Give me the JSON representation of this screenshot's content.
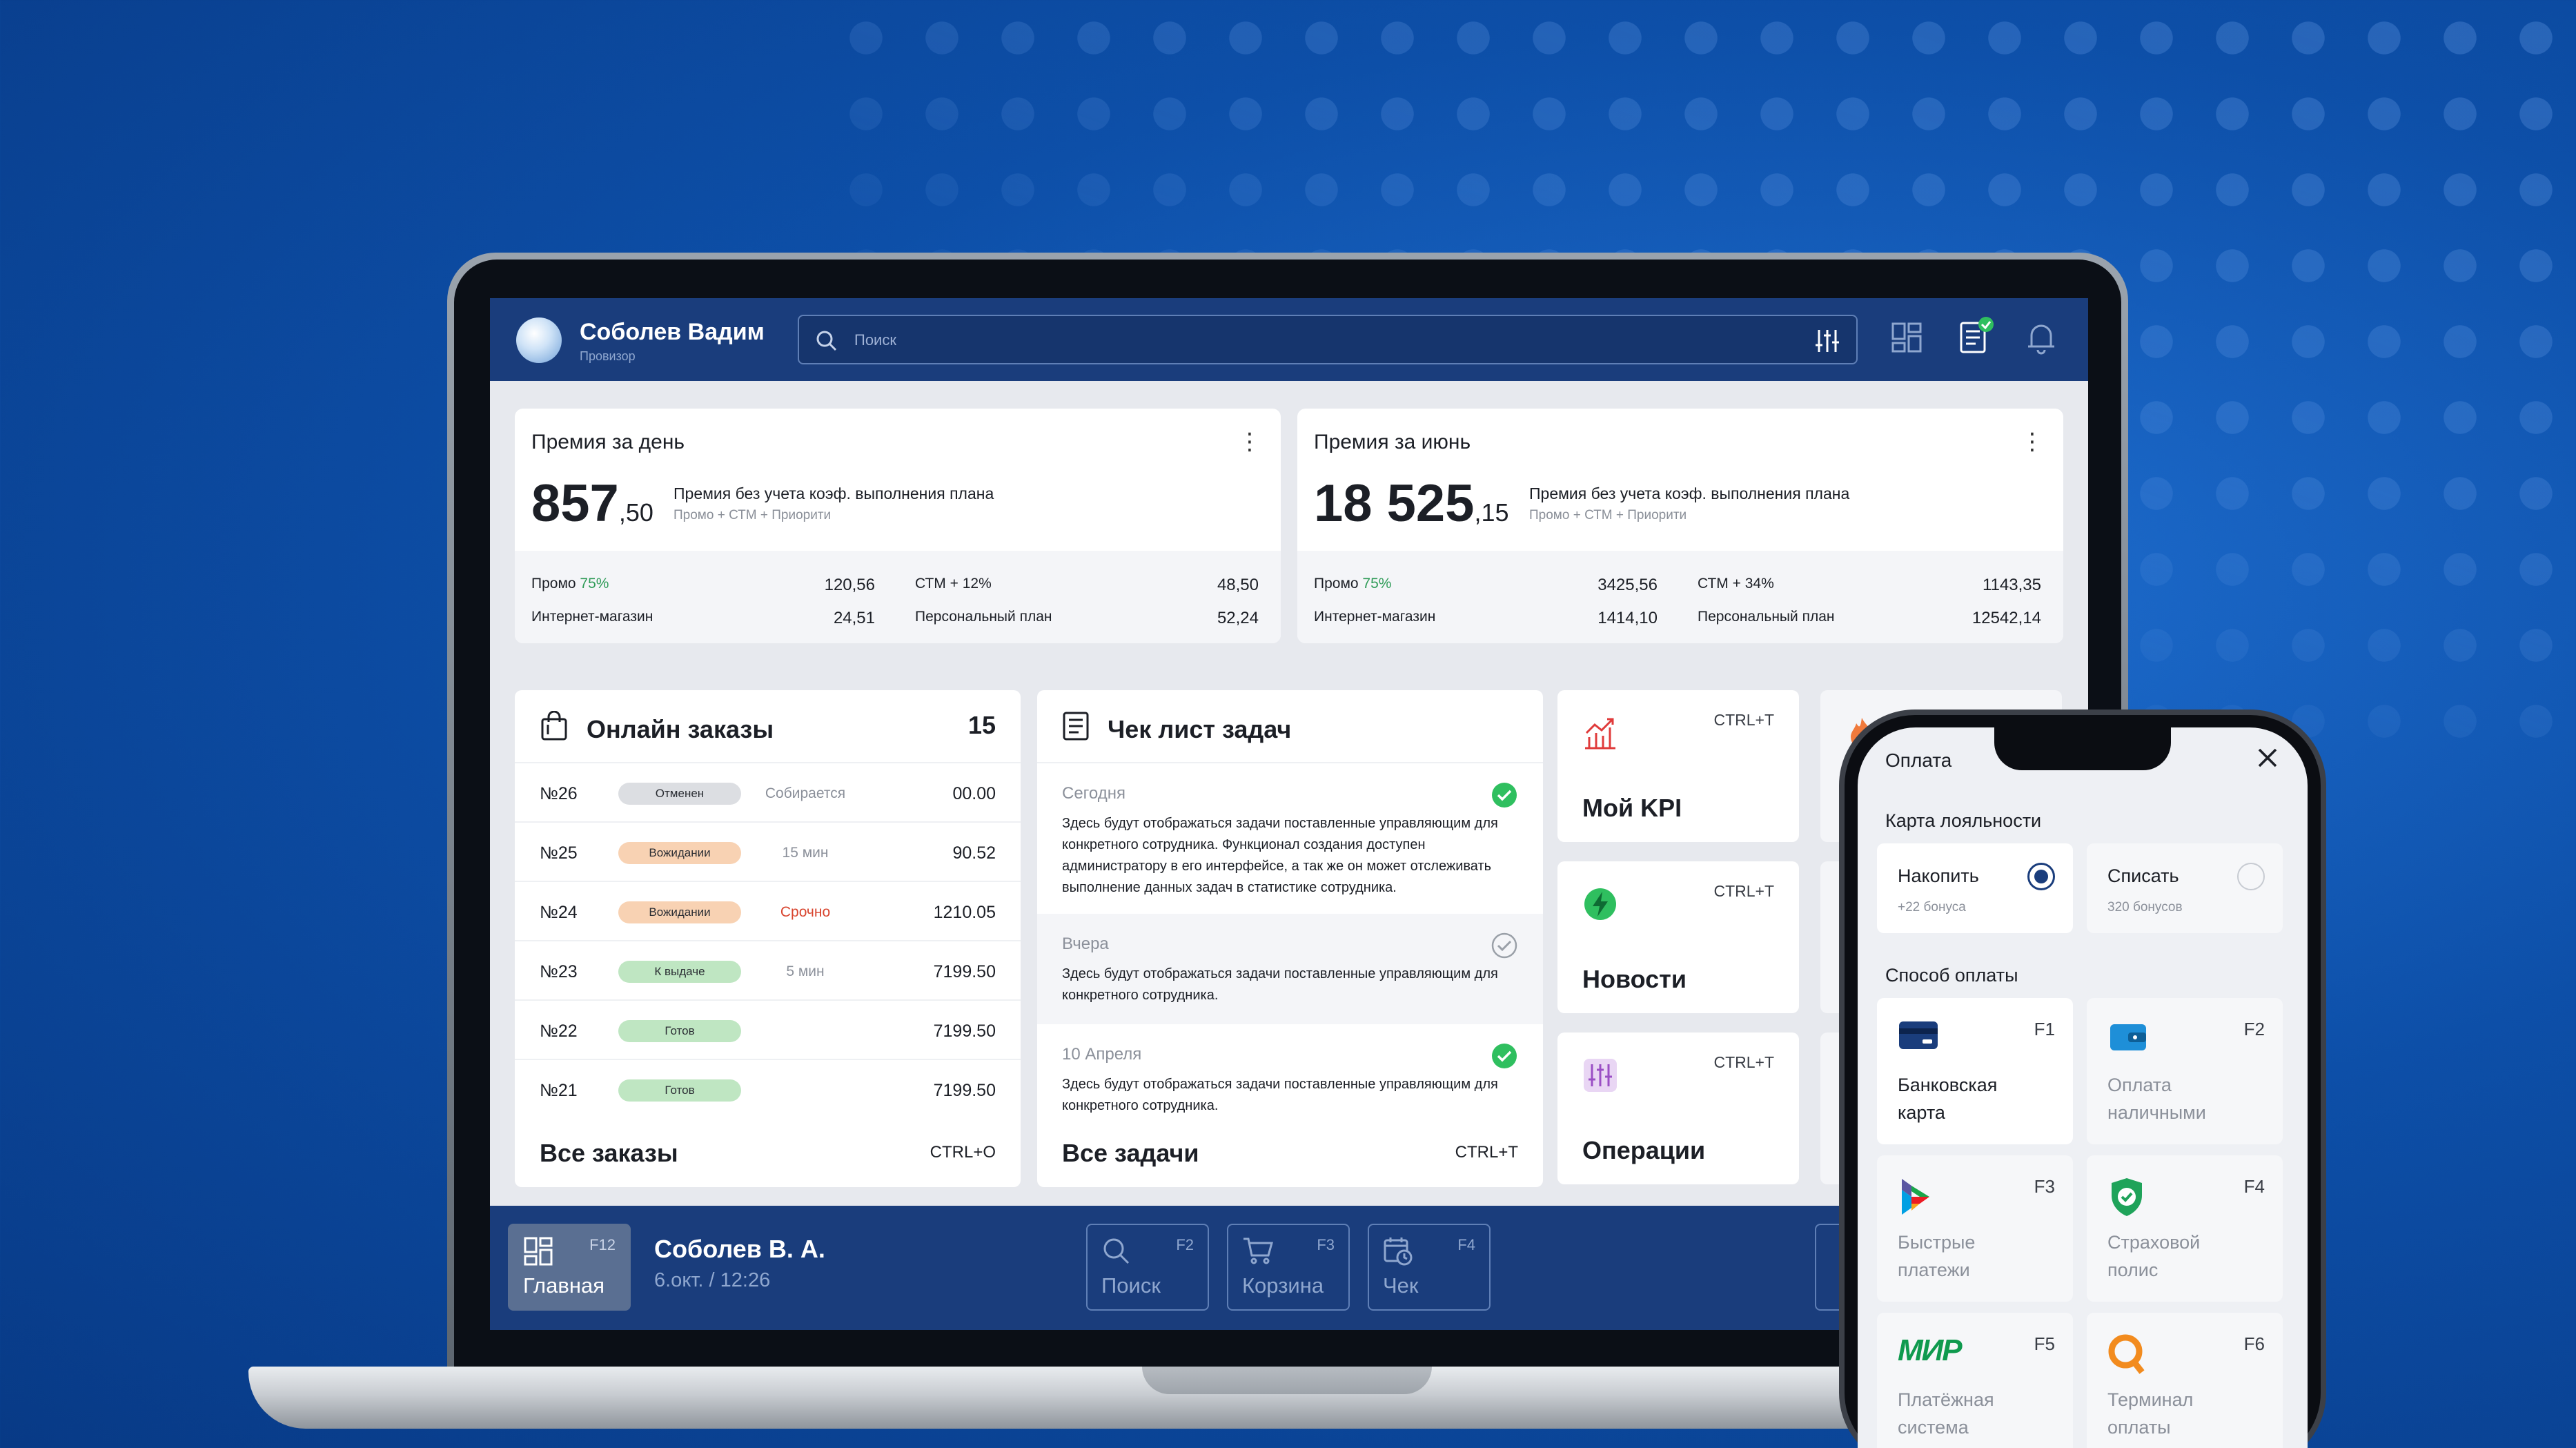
{
  "colors": {
    "brand": "#1a3d7c",
    "accent_green": "#2e9b57",
    "background": "#0d4fa8"
  },
  "header": {
    "user_name": "Соболев Вадим",
    "user_role": "Провизор",
    "search_placeholder": "Поиск",
    "icons": [
      "search-icon",
      "filter-icon",
      "layout-icon",
      "document-check-icon",
      "bell-icon"
    ]
  },
  "premium_day": {
    "title": "Премия за день",
    "amount_int": "857",
    "amount_dec": ",50",
    "desc": "Премия без учета коэф. выполнения плана",
    "sub": "Промо + СТМ + Приорити",
    "left": [
      {
        "label": "Промо",
        "pct": "75%",
        "value": "120,56"
      },
      {
        "label": "Интернет-магазин",
        "pct": "",
        "value": "24,51"
      }
    ],
    "right": [
      {
        "label": "СТМ + 12%",
        "value": "48,50"
      },
      {
        "label": "Персональный план",
        "value": "52,24"
      }
    ]
  },
  "premium_month": {
    "title": "Премия за июнь",
    "amount_int": "18 525",
    "amount_dec": ",15",
    "desc": "Премия без учета коэф. выполнения плана",
    "sub": "Промо + СТМ + Приорити",
    "left": [
      {
        "label": "Промо",
        "pct": "75%",
        "value": "3425,56"
      },
      {
        "label": "Интернет-магазин",
        "pct": "",
        "value": "1414,10"
      }
    ],
    "right": [
      {
        "label": "СТМ + 34%",
        "value": "1143,35"
      },
      {
        "label": "Персональный план",
        "value": "12542,14"
      }
    ]
  },
  "orders": {
    "title": "Онлайн заказы",
    "count": "15",
    "rows": [
      {
        "num": "№26",
        "status": "Отменен",
        "pill_color": "#dcdee2",
        "state": "Собирается",
        "state_color": "#8b909a",
        "amount": "00.00"
      },
      {
        "num": "№25",
        "status": "Вожидании",
        "pill_color": "#f8d2b3",
        "state": "15 мин",
        "state_color": "#8b909a",
        "amount": "90.52"
      },
      {
        "num": "№24",
        "status": "Вожидании",
        "pill_color": "#f8d2b3",
        "state": "Срочно",
        "state_color": "#d8452f",
        "amount": "1210.05"
      },
      {
        "num": "№23",
        "status": "К выдаче",
        "pill_color": "#bfe6c2",
        "state": "5 мин",
        "state_color": "#8b909a",
        "amount": "7199.50"
      },
      {
        "num": "№22",
        "status": "Готов",
        "pill_color": "#bfe6c2",
        "state": "",
        "state_color": "#8b909a",
        "amount": "7199.50"
      },
      {
        "num": "№21",
        "status": "Готов",
        "pill_color": "#bfe6c2",
        "state": "",
        "state_color": "#8b909a",
        "amount": "7199.50"
      }
    ],
    "footer": "Все заказы",
    "shortcut": "CTRL+O"
  },
  "checklist": {
    "title": "Чек лист задач",
    "tasks": [
      {
        "date": "Сегодня",
        "text": "Здесь будут отображаться задачи поставленные управляющим для конкретного сотрудника. Функционал создания доступен администратору в его интерфейсе, а так же он может отслеживать выполнение данных задач в статистике сотрудника.",
        "done": true
      },
      {
        "date": "Вчера",
        "text": "Здесь будут отображаться задачи поставленные управляющим для конкретного сотрудника.",
        "done": false
      },
      {
        "date": "10 Апреля",
        "text": "Здесь будут отображаться задачи поставленные управляющим для конкретного сотрудника.",
        "done": true
      }
    ],
    "footer": "Все задачи",
    "shortcut": "CTRL+T"
  },
  "tiles": [
    {
      "label": "Мой KPI",
      "shortcut": "CTRL+T",
      "icon": "chart-icon"
    },
    {
      "label": "Новости",
      "shortcut": "CTRL+T",
      "icon": "lightning-icon"
    },
    {
      "label": "Операции",
      "shortcut": "CTRL+T",
      "icon": "sliders-icon"
    }
  ],
  "bottom": {
    "home": {
      "label": "Главная",
      "key": "F12"
    },
    "user": "Соболев В. А.",
    "date": "6.окт. / 12:26",
    "buttons": [
      {
        "label": "Поиск",
        "key": "F2"
      },
      {
        "label": "Корзина",
        "key": "F3"
      },
      {
        "label": "Чек",
        "key": "F4"
      }
    ]
  },
  "phone": {
    "title": "Оплата",
    "loyalty_title": "Карта лояльности",
    "loyalty": [
      {
        "label": "Накопить",
        "sub": "+22 бонуса",
        "selected": true
      },
      {
        "label": "Списать",
        "sub": "320 бонусов",
        "selected": false
      }
    ],
    "payment_title": "Способ оплаты",
    "methods": [
      {
        "label1": "Банковская",
        "label2": "карта",
        "key": "F1",
        "icon": "bank-card-icon"
      },
      {
        "label1": "Оплата",
        "label2": "наличными",
        "key": "F2",
        "icon": "wallet-icon"
      },
      {
        "label1": "Быстрые",
        "label2": "платежи",
        "key": "F3",
        "icon": "sbp-icon"
      },
      {
        "label1": "Страховой",
        "label2": "полис",
        "key": "F4",
        "icon": "shield-icon"
      },
      {
        "label1": "Платёжная",
        "label2": "система",
        "key": "F5",
        "icon": "mir-logo-icon",
        "logo_text": "МИР"
      },
      {
        "label1": "Терминал",
        "label2": "оплаты",
        "key": "F6",
        "icon": "terminal-icon"
      }
    ]
  }
}
